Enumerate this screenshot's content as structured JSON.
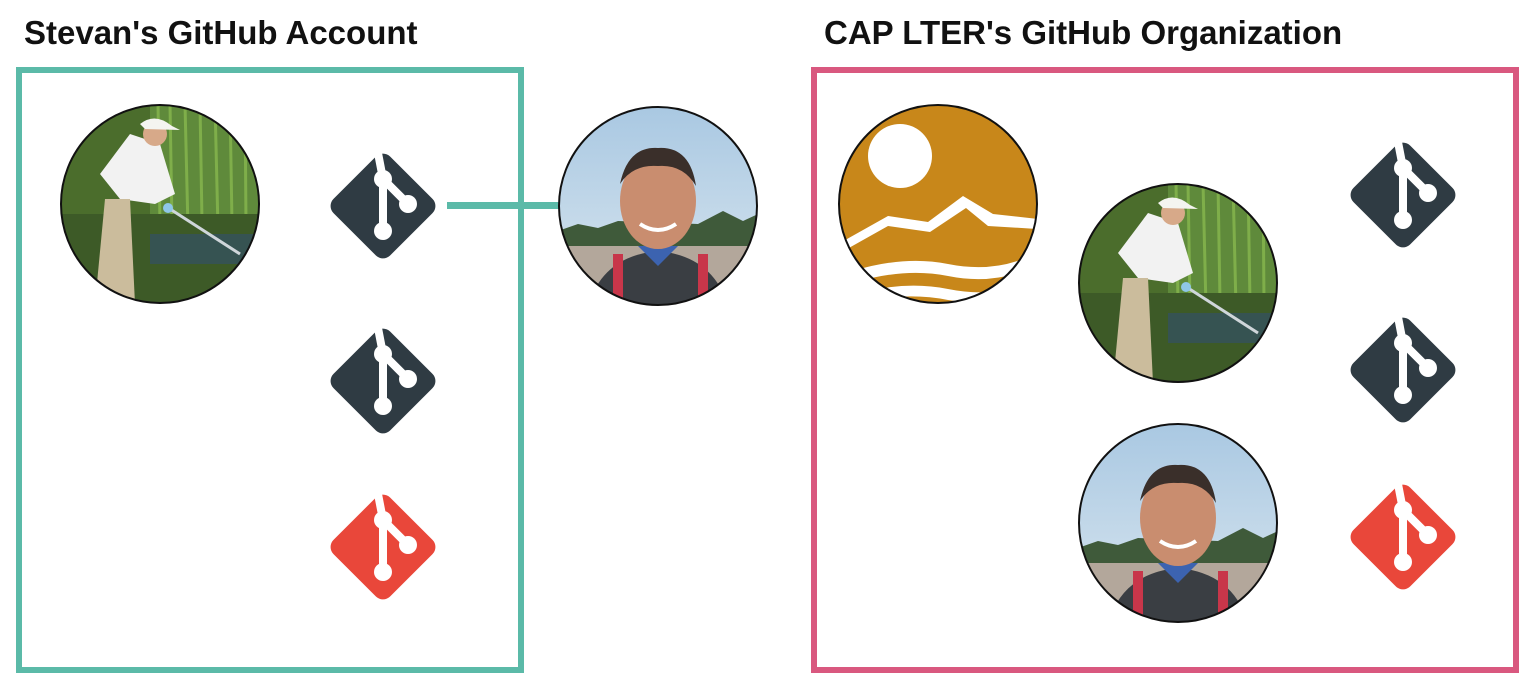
{
  "left_panel": {
    "title": "Stevan's GitHub Account",
    "border_color": "#5bbaa8",
    "avatar_icon": "field-photo-avatar-icon",
    "repos": [
      {
        "icon": "git-logo-icon",
        "color": "#2f3b43"
      },
      {
        "icon": "git-logo-icon",
        "color": "#2f3b43"
      },
      {
        "icon": "git-logo-icon",
        "color": "#e9473a"
      }
    ]
  },
  "connector": {
    "color": "#5bbaa8"
  },
  "collaborator": {
    "avatar_icon": "portrait-photo-avatar-icon"
  },
  "right_panel": {
    "title": "CAP LTER's GitHub Organization",
    "border_color": "#d9587f",
    "org_logo": {
      "icon": "cap-lter-logo-icon",
      "color": "#c8871a"
    },
    "members": [
      {
        "avatar_icon": "field-photo-avatar-icon"
      },
      {
        "avatar_icon": "portrait-photo-avatar-icon"
      }
    ],
    "repos": [
      {
        "icon": "git-logo-icon",
        "color": "#2f3b43"
      },
      {
        "icon": "git-logo-icon",
        "color": "#2f3b43"
      },
      {
        "icon": "git-logo-icon",
        "color": "#e9473a"
      }
    ]
  }
}
